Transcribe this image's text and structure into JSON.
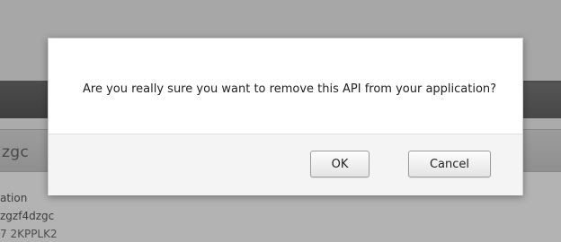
{
  "background": {
    "title": "zgc",
    "label": "ation",
    "value": "zgzf4dzgc",
    "value2": "7 2KPPLK2"
  },
  "dialog": {
    "message": "Are you really sure you want to remove this API from your application?",
    "ok_label": "OK",
    "cancel_label": "Cancel"
  }
}
